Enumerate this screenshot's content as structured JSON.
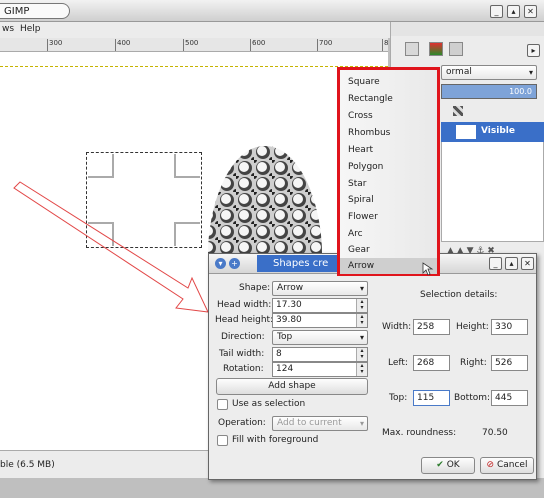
{
  "window": {
    "title": "GIMP"
  },
  "menubar": {
    "views": "ws",
    "help": "Help"
  },
  "ruler": {
    "ticks": [
      "300",
      "400",
      "500",
      "600",
      "700",
      "8"
    ]
  },
  "status": {
    "text": "ble (6.5 MB)"
  },
  "layers": {
    "mode": "ormal",
    "opacity": "100.0",
    "layer_name": "Visible"
  },
  "dropdown": {
    "items": [
      "Square",
      "Rectangle",
      "Cross",
      "Rhombus",
      "Heart",
      "Polygon",
      "Star",
      "Spiral",
      "Flower",
      "Arc",
      "Gear",
      "Arrow"
    ],
    "selected": "Arrow"
  },
  "dialog": {
    "title": "Shapes cre",
    "shape_label": "Shape:",
    "shape_value": "Arrow",
    "head_width_label": "Head width:",
    "head_width": "17.30",
    "head_height_label": "Head height:",
    "head_height": "39.80",
    "direction_label": "Direction:",
    "direction_value": "Top",
    "tail_width_label": "Tail width:",
    "tail_width": "8",
    "rotation_label": "Rotation:",
    "rotation": "124",
    "add_shape": "Add shape",
    "use_selection": "Use as selection",
    "operation_label": "Operation:",
    "operation_value": "Add to current",
    "fill_foreground": "Fill with foreground",
    "selection_details": "Selection details:",
    "width_label": "Width:",
    "width": "258",
    "height_label": "Height:",
    "height": "330",
    "left_label": "Left:",
    "left": "268",
    "right_label": "Right:",
    "right": "526",
    "top_label": "Top:",
    "top": "115",
    "bottom_label": "Bottom:",
    "bottom": "445",
    "roundness_label": "Max. roundness:",
    "roundness": "70.50",
    "ok": "OK",
    "cancel": "Cancel"
  },
  "colors": {
    "highlight": "#e0141c",
    "selected_layer": "#3a6fc8"
  }
}
